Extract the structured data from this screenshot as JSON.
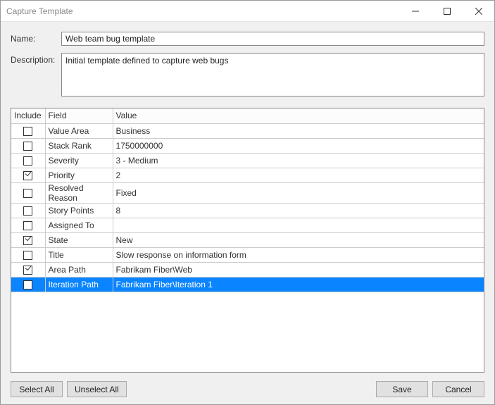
{
  "window": {
    "title": "Capture Template"
  },
  "form": {
    "name_label": "Name:",
    "name_value": "Web team bug template",
    "description_label": "Description:",
    "description_value": "Initial template defined to capture web bugs"
  },
  "grid": {
    "headers": {
      "include": "Include",
      "field": "Field",
      "value": "Value"
    },
    "rows": [
      {
        "include": false,
        "field": "Value Area",
        "value": "Business",
        "selected": false
      },
      {
        "include": false,
        "field": "Stack Rank",
        "value": "1750000000",
        "selected": false
      },
      {
        "include": false,
        "field": "Severity",
        "value": "3 - Medium",
        "selected": false
      },
      {
        "include": true,
        "field": "Priority",
        "value": "2",
        "selected": false
      },
      {
        "include": false,
        "field": "Resolved Reason",
        "value": "Fixed",
        "selected": false
      },
      {
        "include": false,
        "field": "Story Points",
        "value": "8",
        "selected": false
      },
      {
        "include": false,
        "field": "Assigned To",
        "value": "",
        "selected": false
      },
      {
        "include": true,
        "field": "State",
        "value": "New",
        "selected": false
      },
      {
        "include": false,
        "field": "Title",
        "value": "Slow response on information form",
        "selected": false
      },
      {
        "include": true,
        "field": "Area Path",
        "value": "Fabrikam Fiber\\Web",
        "selected": false
      },
      {
        "include": false,
        "field": "Iteration Path",
        "value": "Fabrikam Fiber\\Iteration 1",
        "selected": true
      }
    ]
  },
  "buttons": {
    "select_all": "Select All",
    "unselect_all": "Unselect All",
    "save": "Save",
    "cancel": "Cancel"
  }
}
